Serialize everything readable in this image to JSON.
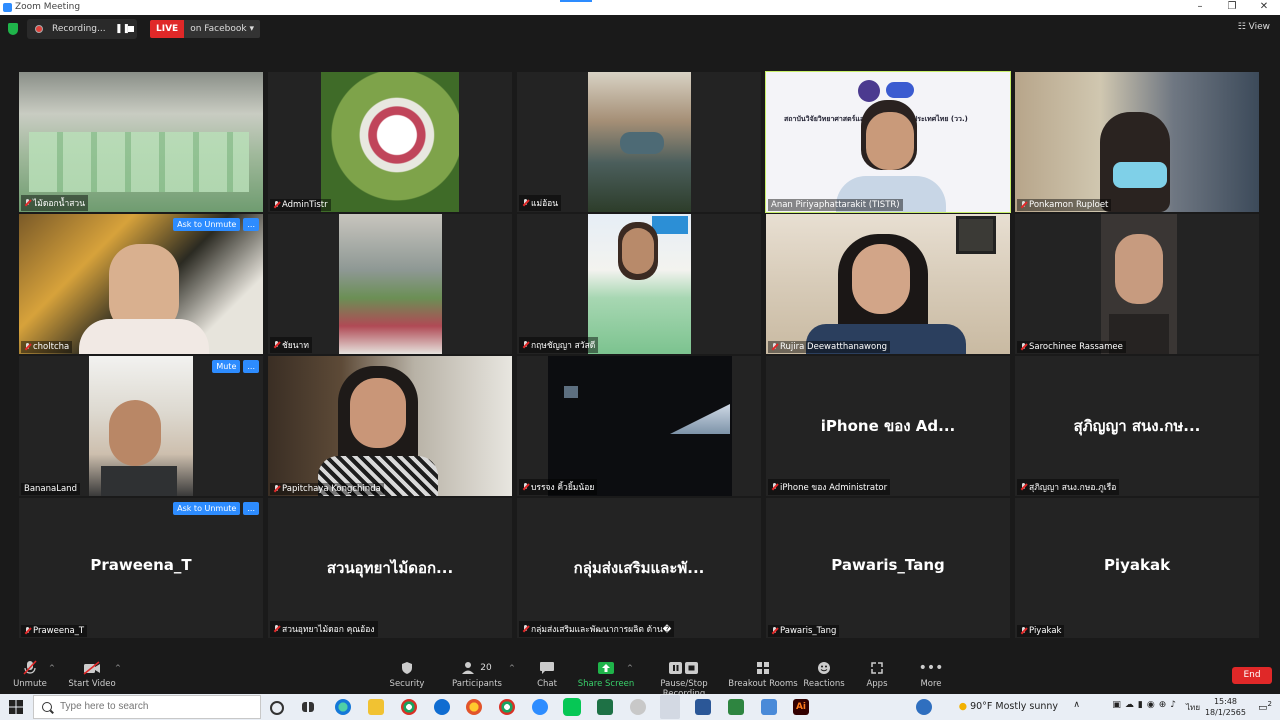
{
  "window": {
    "title": "Zoom Meeting"
  },
  "top": {
    "recording_text": "Recording...",
    "live_label": "LIVE",
    "live_destination": "on Facebook",
    "view_label": "View"
  },
  "tiles": [
    {
      "name": "ไม้ดอกน้ำสวน",
      "mic_off": true
    },
    {
      "name": "AdminTistr",
      "mic_off": true
    },
    {
      "name": "แม่อ้อน",
      "mic_off": true
    },
    {
      "name": "Anan Piriyaphattarakit (TISTR)",
      "mic_off": false,
      "slide_text": "สถาบันวิจัยวิทยาศาสตร์และเทคโนโลยีแห่งประเทศไทย (วว.)"
    },
    {
      "name": "Ponkamon Ruploet",
      "mic_off": true
    },
    {
      "name": "choltcha",
      "mic_off": true,
      "btn1": "Ask to Unmute",
      "btn2": "..."
    },
    {
      "name": "ชัยนาท",
      "mic_off": true
    },
    {
      "name": "กฤษชัญญา สวัสดี",
      "mic_off": true
    },
    {
      "name": "Rujira Deewatthanawong",
      "mic_off": true
    },
    {
      "name": "Sarochinee Rassamee",
      "mic_off": true
    },
    {
      "name": "BananaLand",
      "mic_off": false,
      "btn1": "Mute",
      "btn2": "..."
    },
    {
      "name": "Papitchaya Kongchinda",
      "mic_off": true
    },
    {
      "name": "บรรจง คิ้วยิ้มน้อย",
      "mic_off": true
    },
    {
      "name": "iPhone ของ Administrator",
      "mic_off": true,
      "big": "iPhone ของ Ad..."
    },
    {
      "name": "สุภิญญา สนง.กษอ.ภูเรือ",
      "mic_off": true,
      "big": "สุภิญญา  สนง.กษ..."
    },
    {
      "name": "Praweena_T",
      "mic_off": true,
      "big": "Praweena_T",
      "btn1": "Ask to Unmute",
      "btn2": "..."
    },
    {
      "name": "สวนอุทยาไม้ดอก คุณอ้อง",
      "mic_off": true,
      "big": "สวนอุทยาไม้ดอก..."
    },
    {
      "name": "กลุ่มส่งเสริมและพัฒนาการผลิต ด้าน�",
      "mic_off": true,
      "big": "กลุ่มส่งเสริมและพั..."
    },
    {
      "name": "Pawaris_Tang",
      "mic_off": true,
      "big": "Pawaris_Tang"
    },
    {
      "name": "Piyakak",
      "mic_off": true,
      "big": "Piyakak"
    }
  ],
  "toolbar": {
    "unmute": "Unmute",
    "start_video": "Start Video",
    "security": "Security",
    "participants": "Participants",
    "participants_count": "20",
    "chat": "Chat",
    "share_screen": "Share Screen",
    "pause_stop_recording": "Pause/Stop Recording",
    "breakout_rooms": "Breakout Rooms",
    "reactions": "Reactions",
    "apps": "Apps",
    "more": "More",
    "end": "End"
  },
  "taskbar": {
    "search_placeholder": "Type here to search",
    "weather": "90°F  Mostly sunny",
    "lang": "ไทย",
    "time": "15:48",
    "date": "18/1/2565",
    "notif_count": "2"
  },
  "colors": {
    "zoom_blue": "#2d8cff",
    "live_red": "#e02828",
    "active_speaker": "#c8ef6a",
    "share_green": "#1fb44a"
  }
}
